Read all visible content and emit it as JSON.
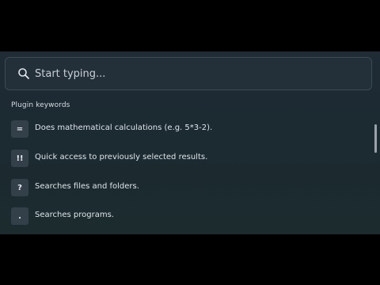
{
  "search": {
    "placeholder": "Start typing...",
    "value": ""
  },
  "section": {
    "label": "Plugin keywords"
  },
  "items": [
    {
      "keyword": "=",
      "description": "Does mathematical calculations (e.g. 5*3-2)."
    },
    {
      "keyword": "!!",
      "description": "Quick access to previously selected results."
    },
    {
      "keyword": "?",
      "description": "Searches files and folders."
    },
    {
      "keyword": ".",
      "description": "Searches programs."
    }
  ],
  "icons": {
    "search": "search-icon"
  },
  "colors": {
    "background": "#000000",
    "panel": "#1f2b35",
    "badge": "#333f49",
    "text": "#dfe5ea"
  }
}
